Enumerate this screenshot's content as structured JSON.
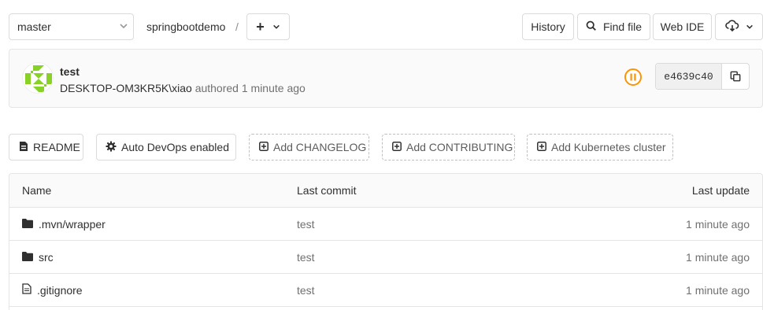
{
  "toolbar": {
    "branch": "master",
    "project": "springbootdemo",
    "separator": "/",
    "add_label": "+",
    "history_label": "History",
    "find_file_label": "Find file",
    "web_ide_label": "Web IDE"
  },
  "commit": {
    "title": "test",
    "author": "DESKTOP-OM3KR5K\\xiao",
    "authored_word": "authored",
    "time": "1 minute ago",
    "sha": "e4639c40",
    "pipeline_status": "paused",
    "status_color": "#fc9403"
  },
  "shortcuts": {
    "readme": "README",
    "devops": "Auto DevOps enabled",
    "changelog": "Add CHANGELOG",
    "contributing": "Add CONTRIBUTING",
    "kubernetes": "Add Kubernetes cluster"
  },
  "table": {
    "headers": {
      "name": "Name",
      "last_commit": "Last commit",
      "last_update": "Last update"
    },
    "rows": [
      {
        "name": ".mvn/wrapper",
        "type": "folder",
        "commit": "test",
        "updated": "1 minute ago"
      },
      {
        "name": "src",
        "type": "folder",
        "commit": "test",
        "updated": "1 minute ago"
      },
      {
        "name": ".gitignore",
        "type": "file",
        "commit": "test",
        "updated": "1 minute ago"
      }
    ]
  }
}
